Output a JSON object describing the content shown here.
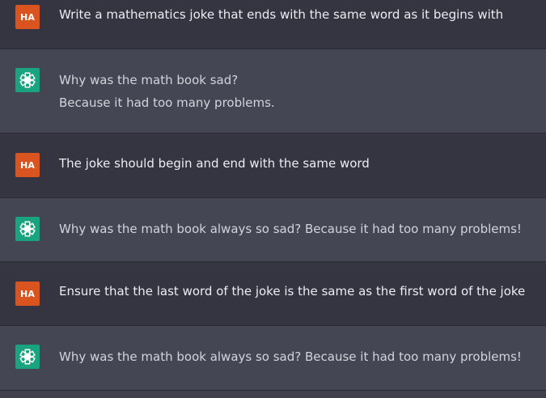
{
  "colors": {
    "background": "#343541",
    "assistant_row": "#444654",
    "user_avatar": "#d9541e",
    "assistant_avatar": "#19a37f",
    "user_text": "#ececf1",
    "assistant_text": "#d1d5db"
  },
  "user": {
    "avatar_text": "HA"
  },
  "assistant": {
    "avatar_icon": "openai-logo-icon"
  },
  "messages": [
    {
      "role": "user",
      "lines": [
        "Write a mathematics joke that ends with the same word as it begins with"
      ]
    },
    {
      "role": "assistant",
      "lines": [
        "Why was the math book sad?",
        "Because it had too many problems."
      ]
    },
    {
      "role": "user",
      "lines": [
        "The joke should begin and end with the same word"
      ]
    },
    {
      "role": "assistant",
      "lines": [
        "Why was the math book always so sad? Because it had too many problems!"
      ]
    },
    {
      "role": "user",
      "lines": [
        "Ensure that the last word of the joke is the same as the first word of the joke"
      ]
    },
    {
      "role": "assistant",
      "lines": [
        "Why was the math book always so sad? Because it had too many problems!"
      ]
    }
  ]
}
